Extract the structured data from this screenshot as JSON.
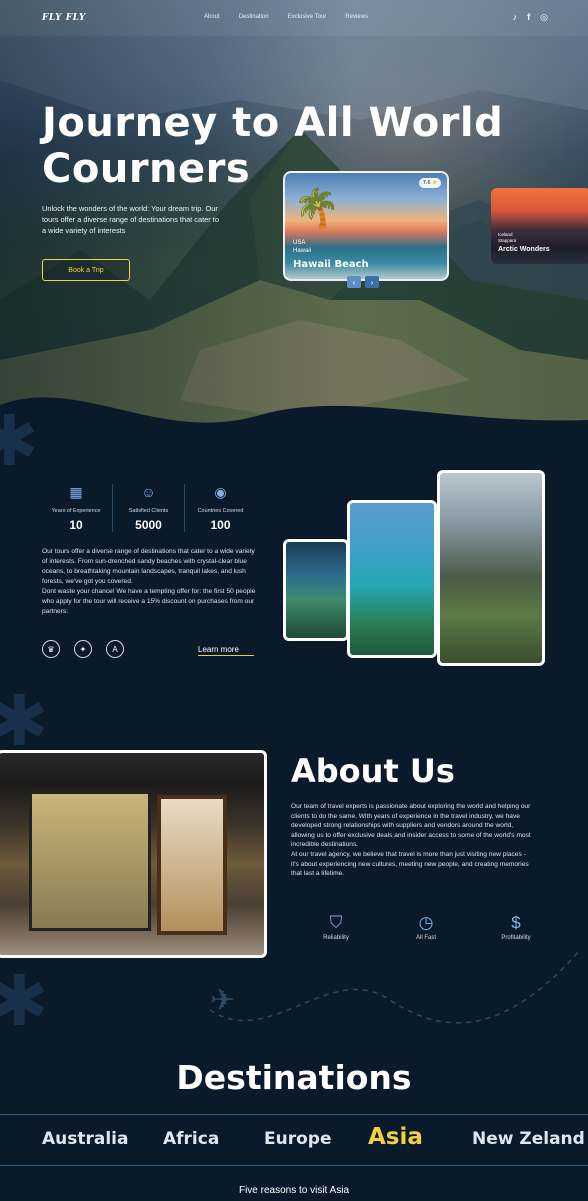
{
  "nav": {
    "logo": "FLY FLY",
    "links": [
      "About",
      "Destination",
      "Exclusive Tour",
      "Reviews"
    ],
    "social_icons": [
      "tiktok-icon",
      "facebook-icon",
      "instagram-icon"
    ]
  },
  "hero": {
    "title_line1": "Journey to All World",
    "title_line2": "Courners",
    "subtitle": "Unlock the wonders of the world: Your dream trip. Our tours offer a diverse range of destinations that cater to a wide variety of interests",
    "cta": "Book a Trip",
    "card_main": {
      "rating": "7.6",
      "country": "USA",
      "region": "Hawaii",
      "name": "Hawaii Beach"
    },
    "card_side": {
      "country": "Iceland",
      "region": "Stappara",
      "name": "Arctic Wonders"
    }
  },
  "stats": [
    {
      "icon": "calendar-icon",
      "label": "Years of Experience",
      "value": "10"
    },
    {
      "icon": "smile-icon",
      "label": "Satisfied Clients",
      "value": "5000"
    },
    {
      "icon": "globe-icon",
      "label": "Countries Covered",
      "value": "100"
    }
  ],
  "intro": {
    "paragraph1": "Our tours offer a diverse range of destinations that cater to a wide variety of interests. From sun-drenched sandy beaches with crystal-clear blue oceans, to breathtaking mountain landscapes, tranquil lakes, and lush forests, we've got you covered.",
    "paragraph2": "Dont waste your chance! We have a tempting offer for: the first 50 people who apply for the tour will receive a 15% discount on purchases from our partners:",
    "learn_more": "Learn more"
  },
  "about": {
    "title": "About Us",
    "paragraph1": "Our team of travel experts is passionate about exploring the world and helping our clients to do the same. With years of experience in the travel industry, we have developed strong relationships with suppliers and vendors around the world, allowing us to offer exclusive deals and insider access to some of the world's most incredible destinations.",
    "paragraph2": "At our travel agency, we believe that travel is more than just visiting new places - it's about experiencing new cultures, meeting new people, and creating memories that last a lifetime.",
    "features": [
      {
        "icon": "shield-check-icon",
        "label": "Reliability"
      },
      {
        "icon": "clock-icon",
        "label": "All Fast"
      },
      {
        "icon": "dollar-icon",
        "label": "Profitability"
      }
    ]
  },
  "destinations": {
    "title": "Destinations",
    "tabs": [
      "Australia",
      "Africa",
      "Europe",
      "Asia",
      "New Zeland"
    ],
    "active_tab": "Asia",
    "reasons_title": "Five reasons to visit Asia"
  },
  "colors": {
    "accent": "#f2d23c",
    "background": "#0b1a2b",
    "icon_blue": "#7eb2e8"
  }
}
